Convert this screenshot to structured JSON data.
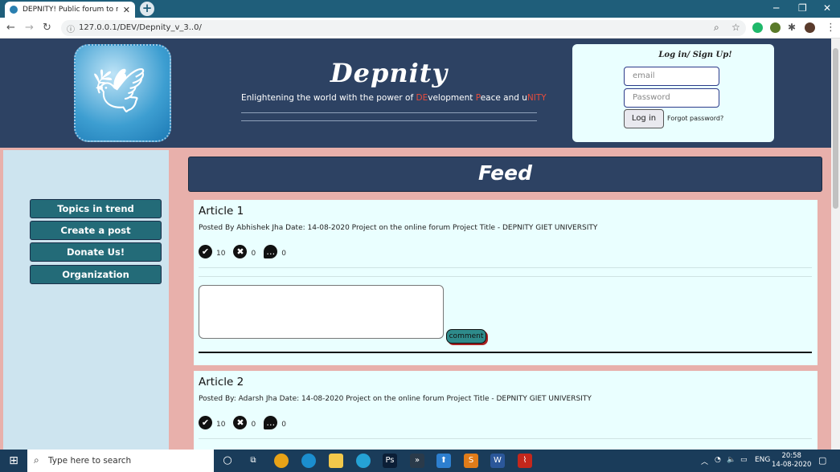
{
  "browser": {
    "tab_title": "DEPNITY! Public forum to resolve",
    "url": "127.0.0.1/DEV/Depnity_v_3..0/"
  },
  "header": {
    "brand": "Depnity",
    "tagline_pre": "Enlightening the world with the power of ",
    "tagline_de": "DE",
    "tagline_mid1": "velopment ",
    "tagline_p": "P",
    "tagline_mid2": "eace and u",
    "tagline_nity": "NITY"
  },
  "login": {
    "title": "Log in/ Sign Up!",
    "email_placeholder": "email",
    "password_placeholder": "Password",
    "login_label": "Log in",
    "forgot_label": "Forgot password?"
  },
  "sidebar": {
    "items": [
      {
        "label": "Topics in trend"
      },
      {
        "label": "Create a post"
      },
      {
        "label": "Donate Us!"
      },
      {
        "label": "Organization"
      }
    ]
  },
  "feed": {
    "title": "Feed",
    "articles": [
      {
        "title": "Article 1",
        "meta": "Posted By Abhishek Jha Date: 14-08-2020 Project on the online forum Project Title - DEPNITY GIET UNIVERSITY",
        "likes": "10",
        "dislikes": "0",
        "comments": "0",
        "comment_button": "comment"
      },
      {
        "title": "Article 2",
        "meta": "Posted By: Adarsh Jha Date: 14-08-2020 Project on the online forum Project Title - DEPNITY GIET UNIVERSITY",
        "likes": "10",
        "dislikes": "0",
        "comments": "0"
      }
    ]
  },
  "taskbar": {
    "search_placeholder": "Type here to search",
    "language": "ENG",
    "time": "20:58",
    "date": "14-08-2020"
  }
}
